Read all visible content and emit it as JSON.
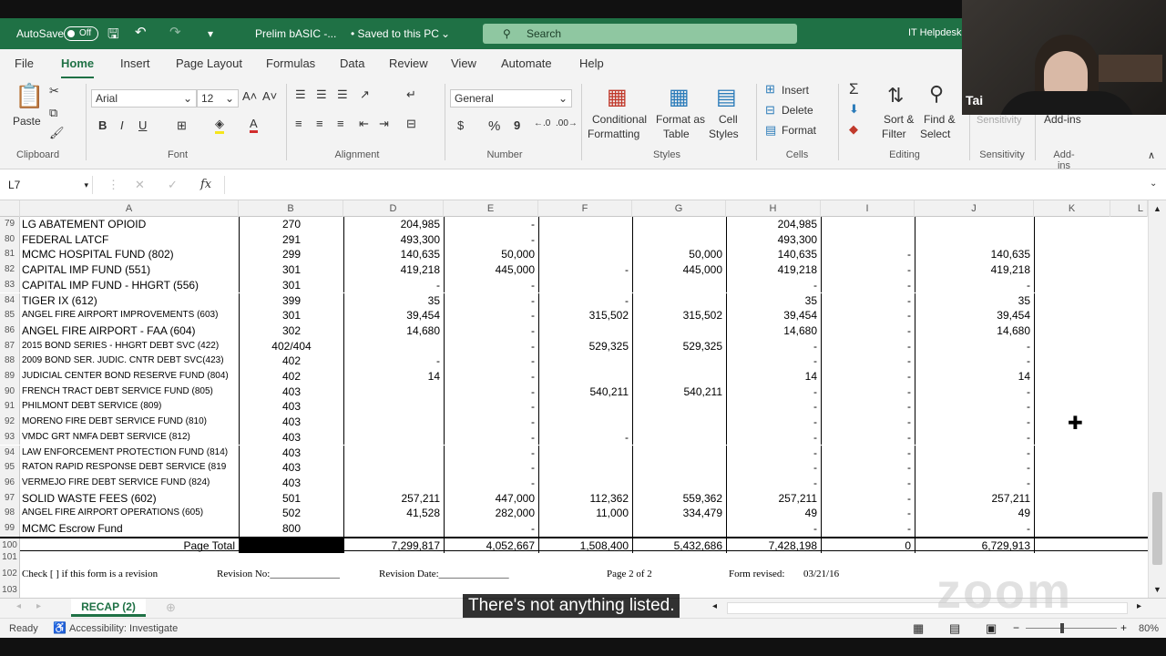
{
  "titlebar": {
    "autosave_label": "AutoSave",
    "autosave_state": "Off",
    "file_title": "Prelim bASIC -...",
    "save_status": "• Saved to this PC",
    "search_placeholder": "Search",
    "account": "IT Helpdesk"
  },
  "menu": [
    "File",
    "Home",
    "Insert",
    "Page Layout",
    "Formulas",
    "Data",
    "Review",
    "View",
    "Automate",
    "Help"
  ],
  "ribbon": {
    "clipboard": {
      "paste": "Paste",
      "group": "Clipboard"
    },
    "font": {
      "name": "Arial",
      "size": "12",
      "group": "Font",
      "bold": "B",
      "italic": "I",
      "underline": "U"
    },
    "alignment": {
      "group": "Alignment"
    },
    "number": {
      "format": "General",
      "currency": "$",
      "percent": "%",
      "comma": "9",
      "group": "Number"
    },
    "styles": {
      "conditional": "Conditional",
      "conditional2": "Formatting",
      "format_as": "Format as",
      "format_as2": "Table",
      "cell": "Cell",
      "cell2": "Styles",
      "group": "Styles"
    },
    "cells": {
      "insert": "Insert",
      "delete": "Delete",
      "format": "Format",
      "group": "Cells"
    },
    "editing": {
      "sort": "Sort &",
      "sort2": "Filter",
      "find": "Find &",
      "find2": "Select",
      "group": "Editing"
    },
    "sensitivity": {
      "label": "Sensitivity",
      "group": "Sensitivity"
    },
    "addins": {
      "label": "Add-ins",
      "group": "Add-ins"
    }
  },
  "formula_bar": {
    "name_box": "L7",
    "fx": "fx",
    "content": ""
  },
  "columns": [
    "A",
    "B",
    "D",
    "E",
    "F",
    "G",
    "H",
    "I",
    "J",
    "K",
    "L"
  ],
  "rows": [
    {
      "n": "79",
      "a": "LG ABATEMENT OPIOID",
      "b": "270",
      "d": "204,985",
      "e": "-",
      "f": "",
      "g": "",
      "h": "204,985",
      "i": "",
      "j": "",
      "small": false
    },
    {
      "n": "80",
      "a": "FEDERAL LATCF",
      "b": "291",
      "d": "493,300",
      "e": "-",
      "f": "",
      "g": "",
      "h": "493,300",
      "i": "",
      "j": "",
      "small": false
    },
    {
      "n": "81",
      "a": "MCMC HOSPITAL FUND (802)",
      "b": "299",
      "d": "140,635",
      "e": "50,000",
      "f": "",
      "g": "50,000",
      "h": "140,635",
      "i": "-",
      "j": "140,635",
      "small": false
    },
    {
      "n": "82",
      "a": "CAPITAL IMP FUND (551)",
      "b": "301",
      "d": "419,218",
      "e": "445,000",
      "f": "-",
      "g": "445,000",
      "h": "419,218",
      "i": "-",
      "j": "419,218",
      "small": false
    },
    {
      "n": "83",
      "a": "CAPITAL IMP FUND - HHGRT (556)",
      "b": "301",
      "d": "-",
      "e": "-",
      "f": "",
      "g": "",
      "h": "-",
      "i": "-",
      "j": "-",
      "small": false
    },
    {
      "n": "84",
      "a": "TIGER IX (612)",
      "b": "399",
      "d": "35",
      "e": "-",
      "f": "-",
      "g": "",
      "h": "35",
      "i": "-",
      "j": "35",
      "small": false
    },
    {
      "n": "85",
      "a": "ANGEL FIRE AIRPORT IMPROVEMENTS (603)",
      "b": "301",
      "d": "39,454",
      "e": "-",
      "f": "315,502",
      "g": "315,502",
      "h": "39,454",
      "i": "-",
      "j": "39,454",
      "small": true
    },
    {
      "n": "86",
      "a": "ANGEL FIRE AIRPORT - FAA (604)",
      "b": "302",
      "d": "14,680",
      "e": "-",
      "f": "",
      "g": "",
      "h": "14,680",
      "i": "-",
      "j": "14,680",
      "small": false
    },
    {
      "n": "87",
      "a": "2015 BOND SERIES - HHGRT DEBT SVC (422)",
      "b": "402/404",
      "d": "",
      "e": "-",
      "f": "529,325",
      "g": "529,325",
      "h": "-",
      "i": "-",
      "j": "-",
      "small": true
    },
    {
      "n": "88",
      "a": "2009 BOND SER. JUDIC. CNTR DEBT SVC(423)",
      "b": "402",
      "d": "-",
      "e": "-",
      "f": "",
      "g": "",
      "h": "-",
      "i": "-",
      "j": "-",
      "small": true
    },
    {
      "n": "89",
      "a": "JUDICIAL CENTER BOND RESERVE FUND (804)",
      "b": "402",
      "d": "14",
      "e": "-",
      "f": "",
      "g": "",
      "h": "14",
      "i": "-",
      "j": "14",
      "small": true
    },
    {
      "n": "90",
      "a": "FRENCH TRACT DEBT SERVICE FUND (805)",
      "b": "403",
      "d": "",
      "e": "-",
      "f": "540,211",
      "g": "540,211",
      "h": "-",
      "i": "-",
      "j": "-",
      "small": true
    },
    {
      "n": "91",
      "a": "PHILMONT DEBT SERVICE (809)",
      "b": "403",
      "d": "",
      "e": "-",
      "f": "",
      "g": "",
      "h": "-",
      "i": "-",
      "j": "-",
      "small": true
    },
    {
      "n": "92",
      "a": "MORENO FIRE DEBT SERVICE FUND (810)",
      "b": "403",
      "d": "",
      "e": "-",
      "f": "",
      "g": "",
      "h": "-",
      "i": "-",
      "j": "-",
      "small": true
    },
    {
      "n": "93",
      "a": "VMDC GRT NMFA DEBT SERVICE (812)",
      "b": "403",
      "d": "",
      "e": "-",
      "f": "-",
      "g": "",
      "h": "-",
      "i": "-",
      "j": "-",
      "small": true
    },
    {
      "n": "94",
      "a": "LAW ENFORCEMENT PROTECTION FUND (814)",
      "b": "403",
      "d": "",
      "e": "-",
      "f": "",
      "g": "",
      "h": "-",
      "i": "-",
      "j": "-",
      "small": true
    },
    {
      "n": "95",
      "a": "RATON RAPID RESPONSE DEBT SERVICE (819",
      "b": "403",
      "d": "",
      "e": "-",
      "f": "",
      "g": "",
      "h": "-",
      "i": "-",
      "j": "-",
      "small": true
    },
    {
      "n": "96",
      "a": "VERMEJO FIRE DEBT SERVICE FUND (824)",
      "b": "403",
      "d": "",
      "e": "-",
      "f": "",
      "g": "",
      "h": "-",
      "i": "-",
      "j": "-",
      "small": true
    },
    {
      "n": "97",
      "a": "SOLID WASTE FEES (602)",
      "b": "501",
      "d": "257,211",
      "e": "447,000",
      "f": "112,362",
      "g": "559,362",
      "h": "257,211",
      "i": "-",
      "j": "257,211",
      "small": false
    },
    {
      "n": "98",
      "a": "ANGEL FIRE AIRPORT OPERATIONS (605)",
      "b": "502",
      "d": "41,528",
      "e": "282,000",
      "f": "11,000",
      "g": "334,479",
      "h": "49",
      "i": "-",
      "j": "49",
      "small": true
    },
    {
      "n": "99",
      "a": "MCMC Escrow Fund",
      "b": "800",
      "d": "",
      "e": "-",
      "f": "",
      "g": "",
      "h": "-",
      "i": "-",
      "j": "-",
      "small": false
    }
  ],
  "total_row": {
    "n": "100",
    "label": "Page Total",
    "d": "7,299,817",
    "e": "4,052,667",
    "f": "1,508,400",
    "g": "5,432,686",
    "h": "7,428,198",
    "i": "0",
    "j": "6,729,913"
  },
  "footer_rows": {
    "r101": "101",
    "r102": "102",
    "r103": "103",
    "check": "Check [   ] if this form is a revision",
    "revision_no": "Revision No:______________",
    "revision_date": "Revision Date:______________",
    "page": "Page 2 of 2",
    "form_revised": "Form revised:",
    "form_revised_date": "03/21/16"
  },
  "sheet_tab": "RECAP (2)",
  "status": {
    "ready": "Ready",
    "accessibility": "Accessibility: Investigate",
    "zoom": "80%"
  },
  "webcam": {
    "name": "Tai"
  },
  "caption": "There's not anything listed.",
  "watermark": "zoom",
  "colors": {
    "excel_green": "#1f7145",
    "ribbon_bg": "#f3f3f3"
  }
}
